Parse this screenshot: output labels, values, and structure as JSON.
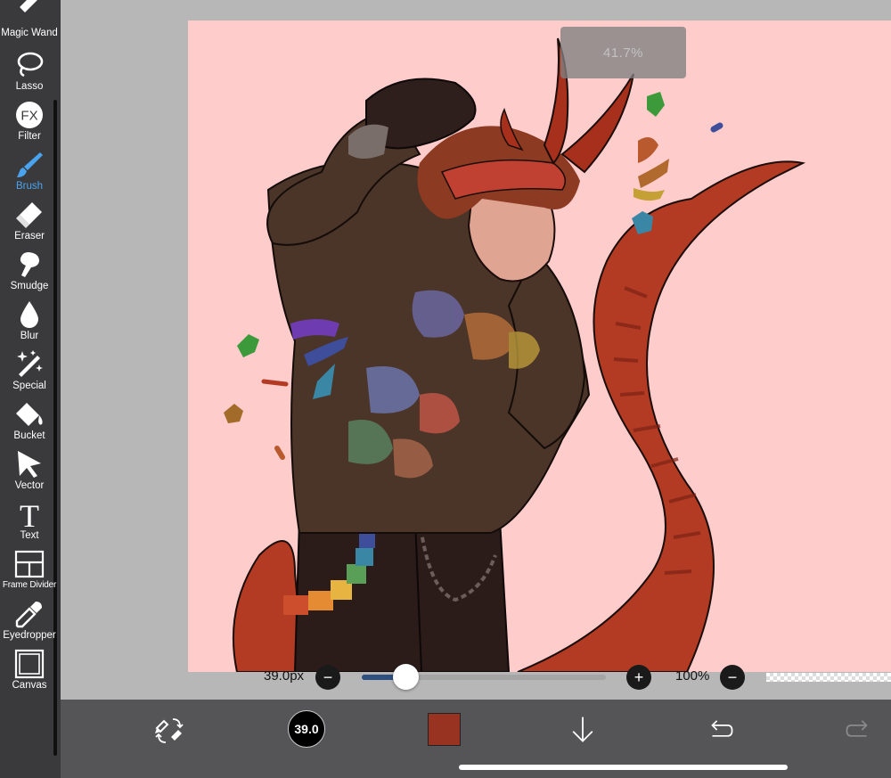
{
  "toolbar": {
    "tools": [
      {
        "id": "magic-wand",
        "label": "Magic Wand",
        "icon": "magic-wand-icon"
      },
      {
        "id": "lasso",
        "label": "Lasso",
        "icon": "lasso-icon"
      },
      {
        "id": "filter",
        "label": "Filter",
        "icon": "fx-icon",
        "icon_text": "FX"
      },
      {
        "id": "brush",
        "label": "Brush",
        "icon": "brush-icon",
        "active": true
      },
      {
        "id": "eraser",
        "label": "Eraser",
        "icon": "eraser-icon"
      },
      {
        "id": "smudge",
        "label": "Smudge",
        "icon": "smudge-icon"
      },
      {
        "id": "blur",
        "label": "Blur",
        "icon": "drop-icon"
      },
      {
        "id": "special",
        "label": "Special",
        "icon": "sparkle-wand-icon"
      },
      {
        "id": "bucket",
        "label": "Bucket",
        "icon": "bucket-icon"
      },
      {
        "id": "vector",
        "label": "Vector",
        "icon": "cursor-arrow-icon"
      },
      {
        "id": "text",
        "label": "Text",
        "icon": "text-icon",
        "icon_text": "T"
      },
      {
        "id": "frame-divider",
        "label": "Frame Divider",
        "icon": "frame-divider-icon"
      },
      {
        "id": "eyedropper",
        "label": "Eyedropper",
        "icon": "eyedropper-icon"
      },
      {
        "id": "canvas",
        "label": "Canvas",
        "icon": "canvas-icon"
      }
    ]
  },
  "zoom_popup": "41.7%",
  "brush_bar": {
    "size_label": "39.0px",
    "size_fraction": 0.18,
    "minus": "−",
    "plus": "+",
    "opacity_label": "100%"
  },
  "bottom_bar": {
    "brush_size_preview": "39.0",
    "current_color": "#973320",
    "icons": [
      "swap-tools-icon",
      "download-arrow-icon",
      "undo-icon",
      "redo-icon"
    ]
  },
  "colors": {
    "accent": "#4aa3ee",
    "toolbar_bg": "#3a3a3c",
    "canvas_bg": "#ffcccc",
    "bottom_bar_bg": "#555557"
  }
}
